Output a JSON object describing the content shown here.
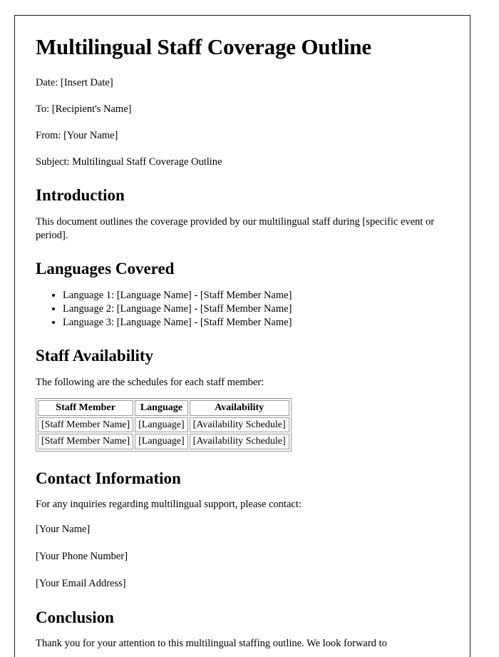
{
  "document": {
    "title": "Multilingual Staff Coverage Outline",
    "header_lines": [
      "Date: [Insert Date]",
      "To: [Recipient's Name]",
      "From: [Your Name]",
      "Subject: Multilingual Staff Coverage Outline"
    ],
    "sections": {
      "introduction": {
        "heading": "Introduction",
        "paragraph": "This document outlines the coverage provided by our multilingual staff during [specific event or period]."
      },
      "languages": {
        "heading": "Languages Covered",
        "items": [
          "Language 1: [Language Name] - [Staff Member Name]",
          "Language 2: [Language Name] - [Staff Member Name]",
          "Language 3: [Language Name] - [Staff Member Name]"
        ]
      },
      "availability": {
        "heading": "Staff Availability",
        "intro": "The following are the schedules for each staff member:",
        "table": {
          "columns": [
            "Staff Member",
            "Language",
            "Availability"
          ],
          "rows": [
            [
              "[Staff Member Name]",
              "[Language]",
              "[Availability Schedule]"
            ],
            [
              "[Staff Member Name]",
              "[Language]",
              "[Availability Schedule]"
            ]
          ]
        }
      },
      "contact": {
        "heading": "Contact Information",
        "intro": "For any inquiries regarding multilingual support, please contact:",
        "lines": [
          "[Your Name]",
          "[Your Phone Number]",
          "[Your Email Address]"
        ]
      },
      "conclusion": {
        "heading": "Conclusion",
        "paragraph": "Thank you for your attention to this multilingual staffing outline. We look forward to"
      }
    }
  },
  "colors": {
    "page_border": "#1c1c1c",
    "table_border": "#9a9a9a",
    "text": "#000000",
    "background": "#ffffff"
  }
}
